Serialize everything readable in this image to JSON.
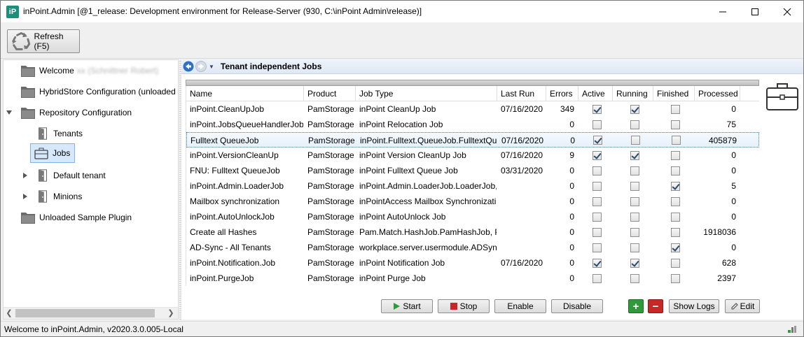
{
  "window": {
    "logo_text": "iP",
    "title": "inPoint.Admin [@1_release: Development environment for Release-Server (930, C:\\inPoint Admin\\release)]"
  },
  "toolbar": {
    "refresh_label": "Refresh (F5)"
  },
  "tree": {
    "items": [
      {
        "label": "Welcome",
        "extra": "xx (Schnittner Robert)"
      },
      {
        "label": "HybridStore Configuration (unloaded"
      },
      {
        "label": "Repository Configuration"
      },
      {
        "label": "Tenants"
      },
      {
        "label": "Jobs"
      },
      {
        "label": "Default tenant"
      },
      {
        "label": "Minions"
      },
      {
        "label": "Unloaded Sample Plugin"
      }
    ]
  },
  "main": {
    "nav_title": "Tenant independent Jobs",
    "columns": [
      "Name",
      "Product",
      "Job Type",
      "Last Run",
      "Errors",
      "Active",
      "Running",
      "Finished",
      "Processed"
    ],
    "rows": [
      {
        "name": "inPoint.CleanUpJob",
        "product": "PamStorage",
        "job_type": "inPoint CleanUp Job",
        "last_run": "07/16/2020",
        "errors": "349",
        "active": true,
        "running": true,
        "finished": false,
        "processed": "0"
      },
      {
        "name": "inPoint.JobsQueueHandlerJob",
        "product": "PamStorage",
        "job_type": "inPoint Relocation Job",
        "last_run": "",
        "errors": "0",
        "active": false,
        "running": false,
        "finished": false,
        "processed": "75"
      },
      {
        "name": "Fulltext QueueJob",
        "product": "PamStorage",
        "job_type": "inPoint.Fulltext.QueueJob.FulltextQu",
        "last_run": "07/16/2020",
        "errors": "0",
        "active": true,
        "running": false,
        "finished": false,
        "processed": "405879"
      },
      {
        "name": "inPoint.VersionCleanUp",
        "product": "PamStorage",
        "job_type": "inPoint Version CleanUp Job",
        "last_run": "07/16/2020",
        "errors": "9",
        "active": true,
        "running": true,
        "finished": false,
        "processed": "0"
      },
      {
        "name": "FNU: Fulltext QueueJob",
        "product": "PamStorage",
        "job_type": "inPoint Fulltext Queue Job",
        "last_run": "03/31/2020",
        "errors": "0",
        "active": false,
        "running": false,
        "finished": false,
        "processed": "0"
      },
      {
        "name": "inPoint.Admin.LoaderJob",
        "product": "PamStorage",
        "job_type": "inPoint.Admin.LoaderJob.LoaderJob,",
        "last_run": "",
        "errors": "0",
        "active": false,
        "running": false,
        "finished": true,
        "processed": "5"
      },
      {
        "name": "Mailbox synchronization",
        "product": "PamStorage",
        "job_type": "inPointAccess Mailbox Synchronizati",
        "last_run": "",
        "errors": "0",
        "active": false,
        "running": false,
        "finished": false,
        "processed": "0"
      },
      {
        "name": "inPoint.AutoUnlockJob",
        "product": "PamStorage",
        "job_type": "inPoint AutoUnlock Job",
        "last_run": "",
        "errors": "0",
        "active": false,
        "running": false,
        "finished": false,
        "processed": "0"
      },
      {
        "name": "Create all Hashes",
        "product": "PamStorage",
        "job_type": "Pam.Match.HashJob.PamHashJob, Pa",
        "last_run": "",
        "errors": "0",
        "active": false,
        "running": false,
        "finished": false,
        "processed": "1918036"
      },
      {
        "name": "AD-Sync - All Tenants",
        "product": "PamStorage",
        "job_type": "workplace.server.usermodule.ADSyn",
        "last_run": "",
        "errors": "0",
        "active": false,
        "running": false,
        "finished": true,
        "processed": "0"
      },
      {
        "name": "inPoint.Notification.Job",
        "product": "PamStorage",
        "job_type": "inPoint Notification Job",
        "last_run": "07/16/2020",
        "errors": "0",
        "active": true,
        "running": true,
        "finished": false,
        "processed": "628"
      },
      {
        "name": "inPoint.PurgeJob",
        "product": "PamStorage",
        "job_type": "inPoint Purge Job",
        "last_run": "",
        "errors": "0",
        "active": false,
        "running": false,
        "finished": false,
        "processed": "2397"
      }
    ],
    "buttons": {
      "start": "Start",
      "stop": "Stop",
      "enable": "Enable",
      "disable": "Disable",
      "add": "+",
      "remove": "−",
      "show_logs": "Show Logs",
      "edit": "Edit"
    }
  },
  "status": {
    "text": "Welcome to inPoint.Admin, v2020.3.0.005-Local"
  },
  "colors": {
    "accent_green": "#2f9a3a",
    "stop_red": "#c62828",
    "logo": "#1a8f7a",
    "selection": "#d6e8fb"
  },
  "icons": [
    "app-logo-icon",
    "minimize-icon",
    "maximize-icon",
    "close-icon",
    "recycle-icon",
    "folder-icon",
    "door-icon",
    "briefcase-icon",
    "back-arrow-icon",
    "forward-arrow-icon",
    "play-icon",
    "stop-icon",
    "plus-icon",
    "minus-icon",
    "pencil-icon",
    "resize-grip-icon"
  ]
}
